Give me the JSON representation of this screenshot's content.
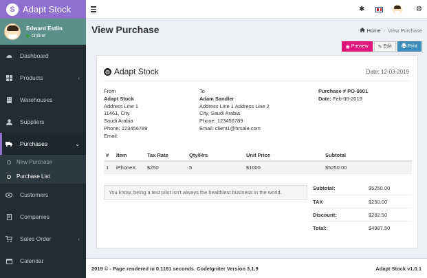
{
  "brand": {
    "logo": "S",
    "title": "Adapt Stock"
  },
  "user": {
    "name": "Edward Estlin",
    "status": "Online"
  },
  "sidebar": {
    "items": [
      {
        "label": "Dashboard",
        "icon": "dashboard-icon"
      },
      {
        "label": "Products",
        "icon": "products-icon",
        "chevron": "‹"
      },
      {
        "label": "Warehouses",
        "icon": "warehouses-icon"
      },
      {
        "label": "Suppliers",
        "icon": "suppliers-icon"
      },
      {
        "label": "Purchases",
        "icon": "purchases-icon",
        "chevron": "⌄"
      },
      {
        "label": "Customers",
        "icon": "customers-icon"
      },
      {
        "label": "Companies",
        "icon": "companies-icon"
      },
      {
        "label": "Sales Order",
        "icon": "sales-order-icon",
        "chevron": "‹"
      },
      {
        "label": "Calendar",
        "icon": "calendar-icon"
      }
    ],
    "submenu": [
      {
        "label": "New Purchase"
      },
      {
        "label": "Purchase List"
      }
    ]
  },
  "topbar": {
    "menu_icon": "hamburger-icon",
    "tools_icon": "asterisk-icon",
    "flag_icon": "uk-flag-icon",
    "settings_icon": "gear-icon"
  },
  "page": {
    "title": "View Purchase"
  },
  "breadcrumb": {
    "home": "Home",
    "current": "View Purchase"
  },
  "actions": {
    "preview": "Preview",
    "edit": "Edit",
    "print": "Print"
  },
  "invoice": {
    "company": "Adapt Stock",
    "date": "Date: 12-03-2019",
    "from": {
      "label": "From",
      "name": "Adapt Stock",
      "line1": "Address Line 1",
      "line2": "11461, City",
      "line3": "Saudi Arabia",
      "phone": "Phone: 123456789",
      "email": "Email:"
    },
    "to": {
      "label": "To",
      "name": "Adam Sandler",
      "line1": "Address Line 1 Address Line 2",
      "line2": "City, Saudi Arabia",
      "phone": "Phone: 123456789",
      "email": "Email: client1@hrsale.com"
    },
    "purchase": {
      "number": "Purchase # PO-0001",
      "date_label": "Date:",
      "date_value": "Feb-06-2019"
    },
    "table": {
      "headers": [
        "#",
        "Item",
        "Tax Rate",
        "Qty/Hrs",
        "Unit Price",
        "Subtotal"
      ],
      "rows": [
        [
          "1",
          "iPhoneX",
          "$250",
          "5",
          "$1000",
          "$5250.00"
        ]
      ]
    },
    "note": "You know, being a test pilot isn't always the healthiest business in the world.",
    "totals": {
      "subtotal_label": "Subtotal:",
      "subtotal": "$5250.00",
      "tax_label": "TAX",
      "tax": "$250.00",
      "discount_label": "Discount:",
      "discount": "$262.50",
      "total_label": "Total:",
      "total": "$4987.50"
    }
  },
  "footer": {
    "left": "2019 © - Page rendered in 0.1161 seconds. CodeIgniter Version 3.1.9",
    "right": "Adapt Stock v1.0.1"
  },
  "colors": {
    "brand": "#8e6fd0",
    "sidebar": "#222d32",
    "preview": "#e0167c",
    "print": "#3c8dbc"
  }
}
